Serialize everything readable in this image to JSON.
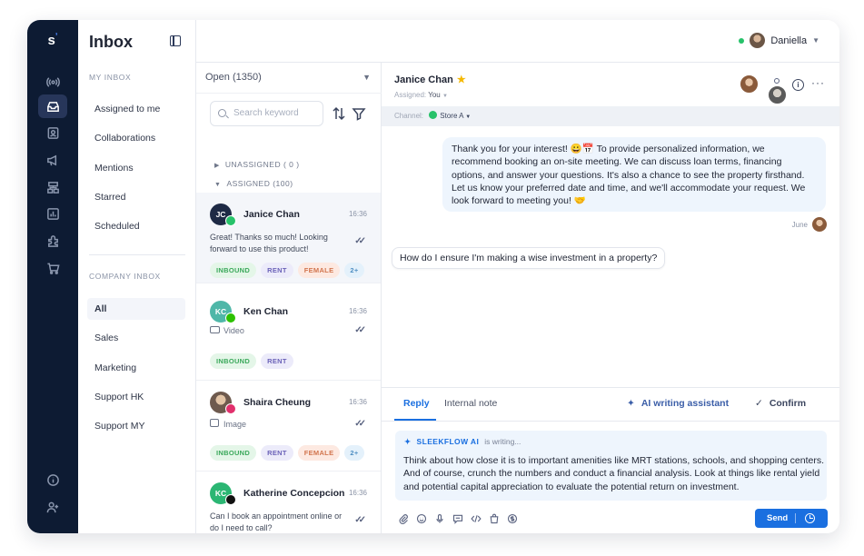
{
  "logo": {
    "letter": "s",
    "accent": "ʼ"
  },
  "rail": {
    "icons": [
      "broadcast-icon",
      "inbox-icon",
      "contacts-icon",
      "campaign-icon",
      "flows-icon",
      "analytics-icon",
      "integrations-icon",
      "commerce-icon"
    ],
    "bottom_icons": [
      "help-icon",
      "add-user-icon"
    ],
    "active": "inbox-icon"
  },
  "sidebar": {
    "title": "Inbox",
    "my_inbox_title": "MY INBOX",
    "my_inbox": [
      "Assigned to me",
      "Collaborations",
      "Mentions",
      "Starred",
      "Scheduled"
    ],
    "company_inbox_title": "COMPANY INBOX",
    "company_inbox": [
      "All",
      "Sales",
      "Marketing",
      "Support HK",
      "Support MY"
    ],
    "active": "All"
  },
  "user": {
    "name": "Daniella",
    "status": "online"
  },
  "conversation_list": {
    "filter": "Open (1350)",
    "search_placeholder": "Search keyword",
    "groups": {
      "unassigned": "UNASSIGNED ( 0 )",
      "assigned": "ASSIGNED (100)"
    },
    "items": [
      {
        "initials": "JC",
        "name": "Janice Chan",
        "time": "16:36",
        "message": "Great! Thanks so much! Looking forward to use this product!",
        "channel": "whatsapp",
        "tags": [
          "INBOUND",
          "RENT",
          "FEMALE",
          "2+"
        ]
      },
      {
        "initials": "KC",
        "name": "Ken Chan",
        "time": "16:36",
        "message": "Video",
        "channel": "wechat",
        "tags": [
          "INBOUND",
          "RENT"
        ]
      },
      {
        "initials": "",
        "name": "Shaira Cheung",
        "time": "16:36",
        "message": "Image",
        "channel": "instagram",
        "tags": [
          "INBOUND",
          "RENT",
          "FEMALE",
          "2+"
        ]
      },
      {
        "initials": "KC",
        "name": "Katherine Concepcion",
        "time": "16:36",
        "message": "Can I book an appointment online or do I need to call?",
        "channel": "tiktok",
        "tags": []
      }
    ]
  },
  "chat": {
    "contact_name": "Janice Chan",
    "assigned_label": "Assigned:",
    "assigned_value": "You",
    "channel_label": "Channel:",
    "channel_value": "Store A",
    "outgoing": {
      "text": "Thank you for your interest! 😀📅  To provide personalized information, we recommend booking an on-site meeting. We can discuss loan terms, financing options, and answer your questions. It's also a chance to see the property firsthand. Let us know your preferred date and time, and we'll accommodate your request. We look forward to meeting you! 🤝",
      "sender": "June"
    },
    "incoming": {
      "text": "How do I ensure I'm making a wise investment in a property?"
    }
  },
  "composer": {
    "tabs": [
      "Reply",
      "Internal note"
    ],
    "active_tab": "Reply",
    "ai_assistant": "AI writing assistant",
    "confirm": "Confirm",
    "ai_name": "SLEEKFLOW AI",
    "ai_status": "is writing...",
    "ai_text": "Think about how close it is to important amenities like MRT stations, schools, and shopping centers. And of course, crunch the numbers and conduct a financial analysis. Look at things like rental yield and potential capital appreciation to evaluate the potential return on investment.",
    "tools": [
      "attach-icon",
      "emoji-icon",
      "mic-icon",
      "template-icon",
      "code-icon",
      "bag-icon",
      "payment-icon"
    ],
    "send": "Send"
  },
  "colors": {
    "primary": "#1a6fe0",
    "rail_bg": "#0d1b33",
    "online": "#27c26a"
  }
}
